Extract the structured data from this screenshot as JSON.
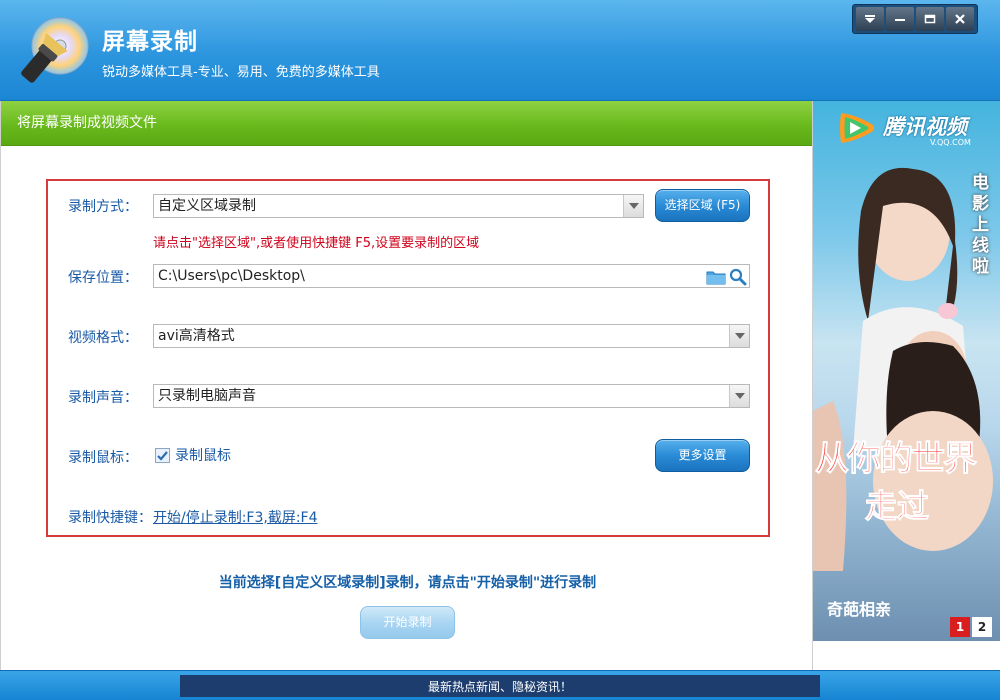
{
  "app": {
    "title": "屏幕录制",
    "subtitle": "锐动多媒体工具-专业、易用、免费的多媒体工具"
  },
  "section_title": "将屏幕录制成视频文件",
  "form": {
    "record_mode_label": "录制方式：",
    "record_mode_value": "自定义区域录制",
    "select_area_button": "选择区域 (F5)",
    "hint": "请点击\"选择区域\",或者使用快捷键 F5,设置要录制的区域",
    "save_location_label": "保存位置：",
    "save_location_value": "C:\\Users\\pc\\Desktop\\",
    "video_format_label": "视频格式：",
    "video_format_value": "avi高清格式",
    "audio_label": "录制声音：",
    "audio_value": "只录制电脑声音",
    "mouse_label": "录制鼠标：",
    "mouse_checkbox_label": "录制鼠标",
    "mouse_checked": true,
    "more_settings_button": "更多设置",
    "shortcut_label": "录制快捷键：",
    "shortcut_link": "开始/停止录制:F3,截屏:F4"
  },
  "status_text": "当前选择[自定义区域录制]录制，请点击\"开始录制\"进行录制",
  "start_button": "开始录制",
  "ad": {
    "brand": "腾讯视频",
    "url": "V.QQ.COM",
    "vertical_text": "电影上线啦",
    "headline_1": "从你的世界",
    "headline_2": "走过",
    "footer": "奇葩相亲",
    "pages": [
      "1",
      "2"
    ]
  },
  "news_bar": "最新热点新闻、隐秘资讯！",
  "colors": {
    "header_blue": "#2c95de",
    "green_bar": "#69b91d",
    "red_border": "#d63b3b",
    "label_blue": "#1a5aa6",
    "hint_red": "#d0021b"
  }
}
